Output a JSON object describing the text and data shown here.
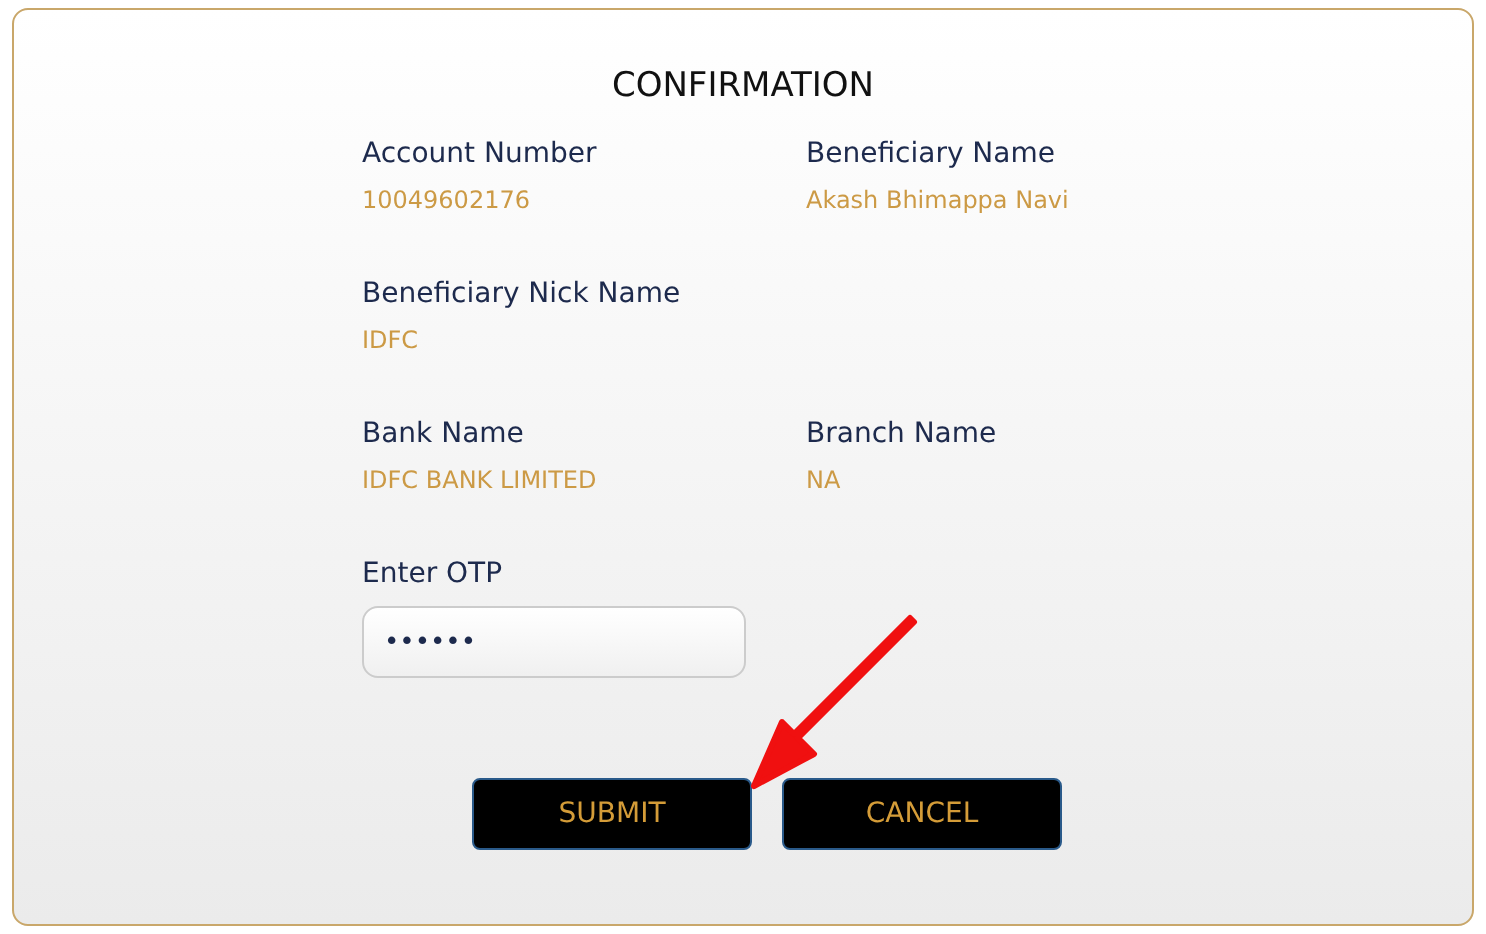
{
  "title": "CONFIRMATION",
  "details": [
    {
      "label": "Account Number",
      "value": "10049602176"
    },
    {
      "label": "Beneficiary Name",
      "value": "Akash Bhimappa Navi"
    },
    {
      "label": "Beneficiary Nick Name",
      "value": "IDFC",
      "kind": "wide"
    },
    {
      "label": "Bank Name",
      "value": "IDFC BANK LIMITED"
    },
    {
      "label": "Branch Name",
      "value": "NA"
    }
  ],
  "otp": {
    "label": "Enter OTP",
    "value": "••••••"
  },
  "buttons": [
    "SUBMIT",
    "CANCEL"
  ]
}
